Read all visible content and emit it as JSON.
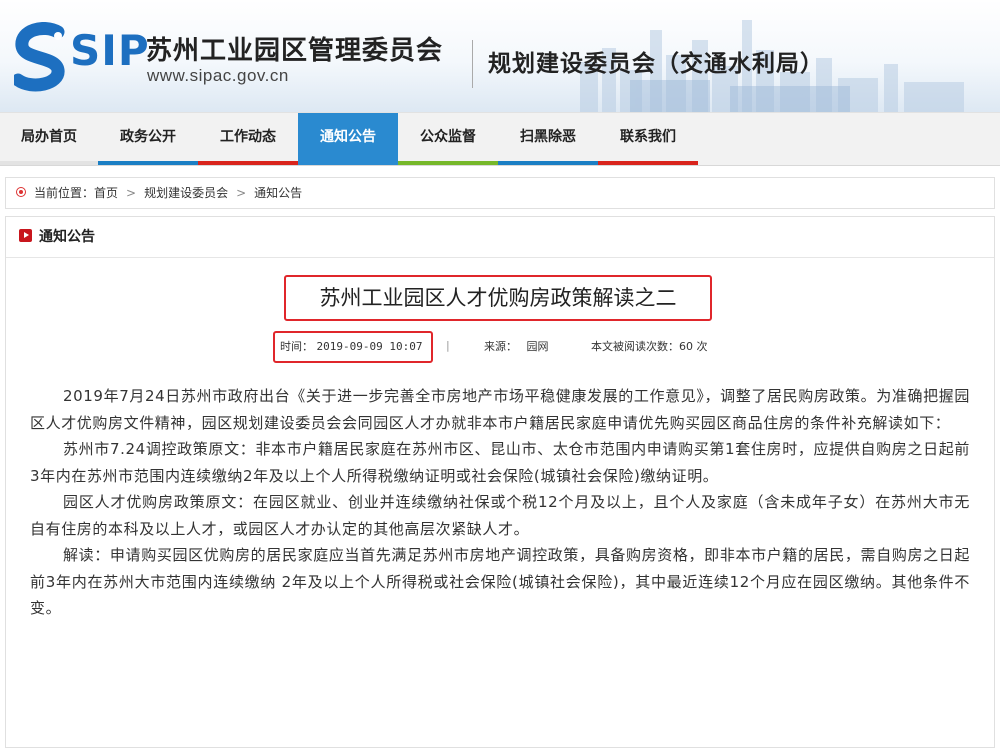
{
  "header": {
    "logo_text": "SIP",
    "org_name": "苏州工业园区管理委员会",
    "org_url": "www.sipac.gov.cn",
    "dept_name": "规划建设委员会（交通水利局）",
    "brand_color": "#1d6fc0"
  },
  "nav": {
    "items": [
      {
        "label": "局办首页",
        "bar_color": "#e3e3e3"
      },
      {
        "label": "政务公开",
        "bar_color": "#1b7fc4"
      },
      {
        "label": "工作动态",
        "bar_color": "#d9241c"
      },
      {
        "label": "通知公告",
        "bar_color": "#2a8ad0",
        "active": true
      },
      {
        "label": "公众监督",
        "bar_color": "#76b82a"
      },
      {
        "label": "扫黑除恶",
        "bar_color": "#1b7fc4"
      },
      {
        "label": "联系我们",
        "bar_color": "#d9241c"
      }
    ],
    "active_color": "#2a8ad0"
  },
  "breadcrumb": {
    "prefix": "当前位置：",
    "items": [
      "首页",
      "规划建设委员会",
      "通知公告"
    ],
    "separator": ">"
  },
  "section": {
    "title": "通知公告"
  },
  "article": {
    "title": "苏州工业园区人才优购房政策解读之二",
    "time_label": "时间：",
    "time_value": "2019-09-09 10:07",
    "meta_separator": "|",
    "source_label": "来源：",
    "source_value": "园网",
    "reads_label": "本文被阅读次数：",
    "reads_value": "60 次",
    "highlight_color": "#e0262b",
    "paragraphs": [
      "2019年7月24日苏州市政府出台《关于进一步完善全市房地产市场平稳健康发展的工作意见》，调整了居民购房政策。为准确把握园区人才优购房文件精神，园区规划建设委员会会同园区人才办就非本市户籍居民家庭申请优先购买园区商品住房的条件补充解读如下：",
      "苏州市7.24调控政策原文：非本市户籍居民家庭在苏州市区、昆山市、太仓市范围内申请购买第1套住房时，应提供自购房之日起前3年内在苏州市范围内连续缴纳2年及以上个人所得税缴纳证明或社会保险(城镇社会保险)缴纳证明。",
      "园区人才优购房政策原文：在园区就业、创业并连续缴纳社保或个税12个月及以上，且个人及家庭（含未成年子女）在苏州大市无自有住房的本科及以上人才，或园区人才办认定的其他高层次紧缺人才。",
      "解读：申请购买园区优购房的居民家庭应当首先满足苏州市房地产调控政策，具备购房资格，即非本市户籍的居民，需自购房之日起前3年内在苏州大市范围内连续缴纳 2年及以上个人所得税或社会保险(城镇社会保险)，其中最近连续12个月应在园区缴纳。其他条件不变。"
    ]
  }
}
